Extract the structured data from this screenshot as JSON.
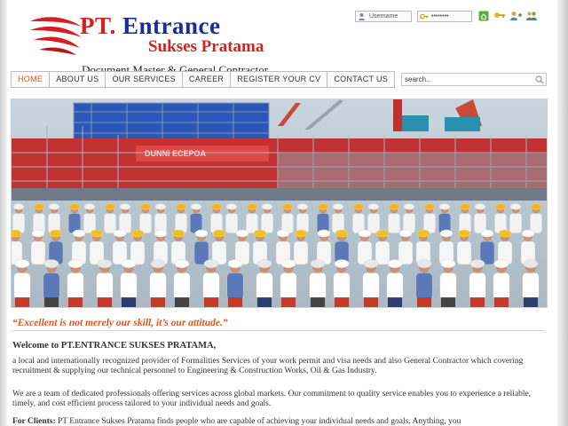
{
  "header": {
    "logo": {
      "pt": "PT.",
      "name_1": "Entrance",
      "name_2": "Sukses Pratama",
      "tagline": "Document Master & General Contractor"
    },
    "login": {
      "username_placeholder": "Username",
      "password_mask": "••••••••",
      "icons": [
        "home-icon",
        "key-icon",
        "user-add-icon",
        "users-icon"
      ]
    }
  },
  "nav": {
    "items": [
      {
        "label": "HOME",
        "active": true
      },
      {
        "label": "ABOUT US",
        "active": false
      },
      {
        "label": "OUR SERVICES",
        "active": false
      },
      {
        "label": "CAREER",
        "active": false
      },
      {
        "label": "REGISTER YOUR CV",
        "active": false
      },
      {
        "label": "CONTACT US",
        "active": false
      }
    ],
    "search_value": "search.."
  },
  "hero": {
    "sign_text": "DUNNI ECEPOA"
  },
  "content": {
    "quote": "“Excellent is not merely our skill, it’s our attitude.”",
    "welcome": "Welcome to PT.ENTRANCE SUKSES PRATAMA,",
    "paragraph_1": "a local and internationally recognized provider of Formalities Services of your work permit and visa needs and also General Contractor which covering recruitment & supplying our technical personnel to Engineering & Construction Works, Oil & Gas Industry.",
    "paragraph_2": "We are a team of dedicated professionals offering services across global markets. Our commitment to quality service enables you to experience a reliable, timely, and cost efficient process tailored to your individual needs and goals.",
    "paragraph_3_label": "For Clients:",
    "paragraph_3": " PT Entrance Sukses Pratama finds people who are capable of achieving your individual needs and goals. Anything, you"
  },
  "colors": {
    "brand_blue": "#1b2c97",
    "brand_red": "#d42020",
    "accent_orange": "#e0561b"
  }
}
